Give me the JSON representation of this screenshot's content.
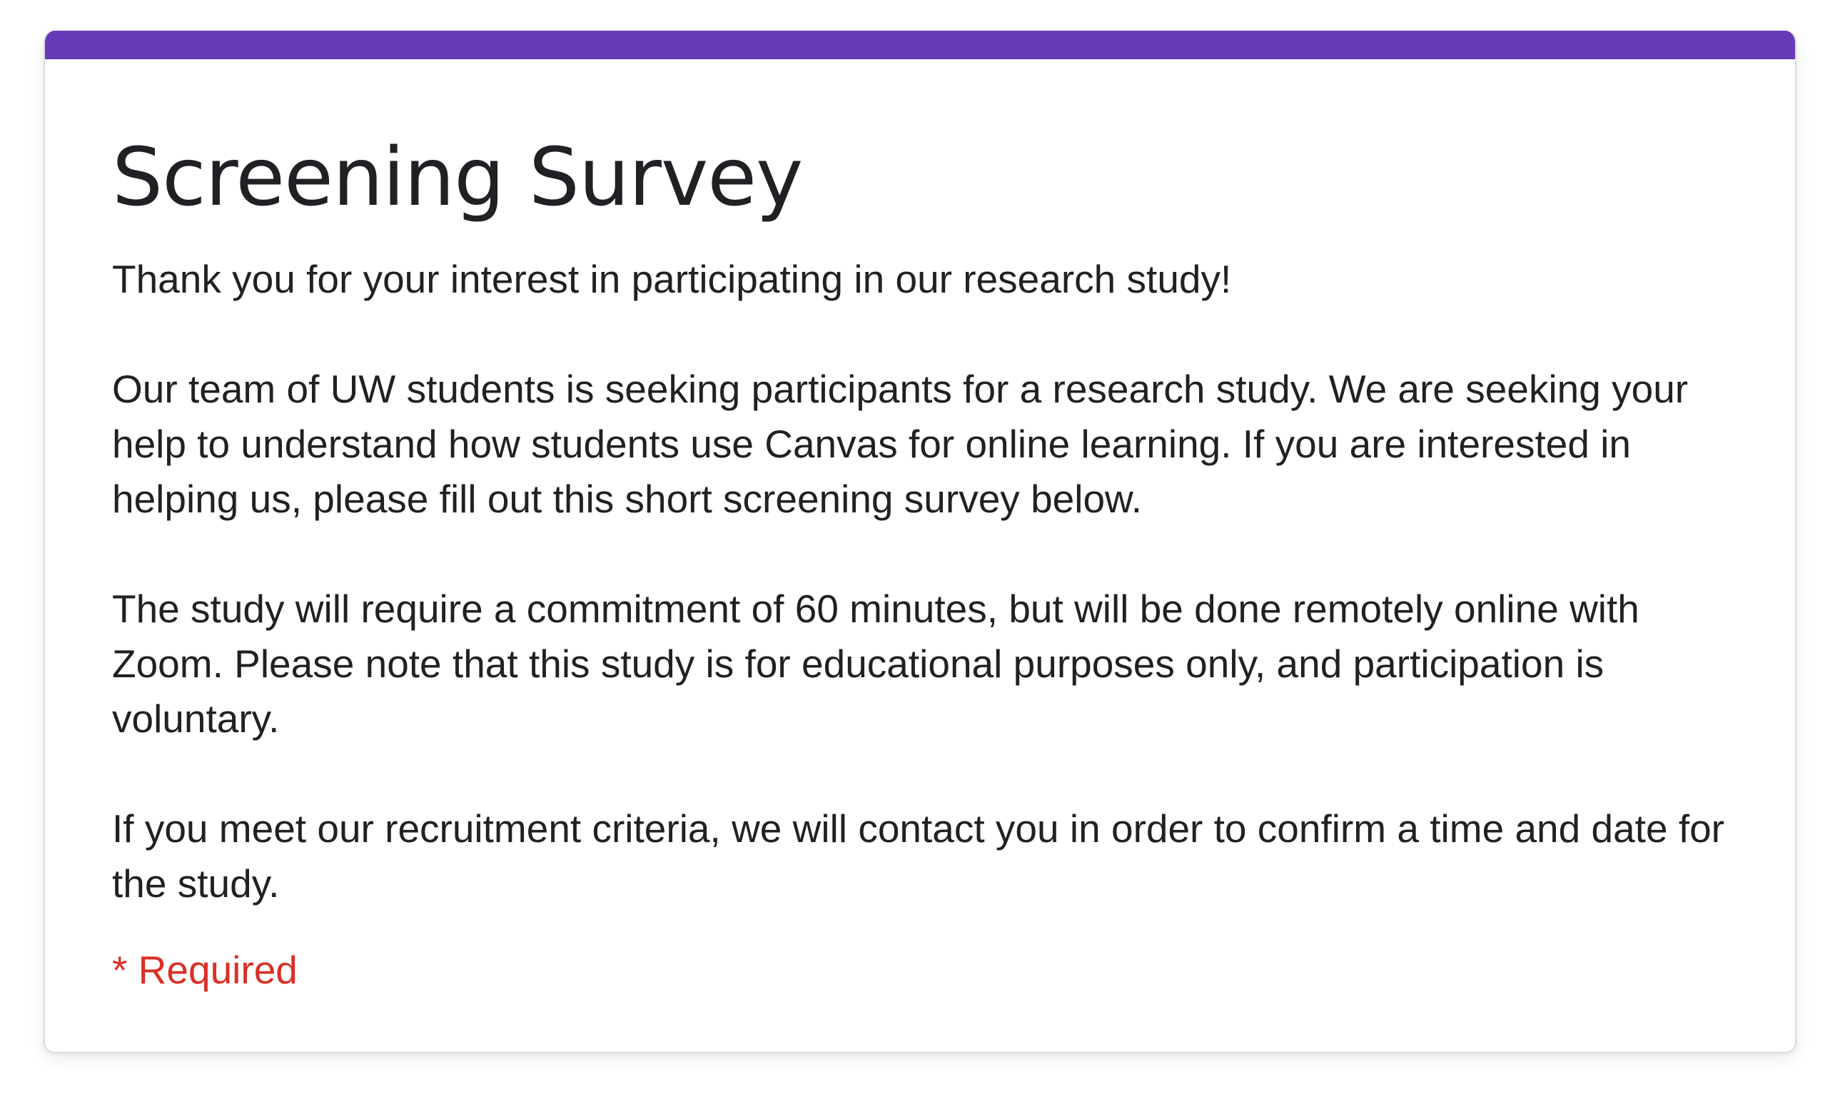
{
  "form": {
    "title": "Screening Survey",
    "paragraphs": [
      "Thank you for your interest in participating in our research study!",
      "Our team of UW students is seeking participants for a research study. We are seeking your help to understand how students use Canvas for online learning. If you are interested in helping us, please fill out this short screening survey below.",
      "The study will require a commitment of 60 minutes, but will be done remotely online with Zoom. Please note that this study is for educational purposes only, and participation is voluntary.",
      "If you meet our recruitment criteria, we will contact you in order to confirm a time and date for the study."
    ],
    "required_note": "* Required"
  },
  "colors": {
    "accent": "#673ab7",
    "required": "#d93025",
    "text": "#202124"
  }
}
